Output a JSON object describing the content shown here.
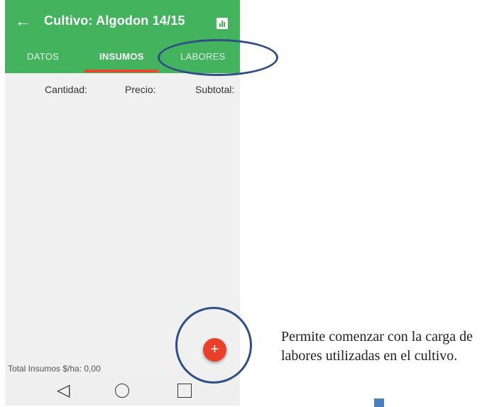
{
  "appbar": {
    "title": "Cultivo: Algodon 14/15",
    "back_icon": "arrow-left-icon",
    "chart_icon": "bar-chart-icon"
  },
  "tabs": [
    {
      "label": "DATOS",
      "active": false
    },
    {
      "label": "INSUMOS",
      "active": true
    },
    {
      "label": "LABORES",
      "active": false
    }
  ],
  "columns": {
    "cantidad": "Cantidad:",
    "precio": "Precio:",
    "subtotal": "Subtotal:"
  },
  "footer": {
    "total_label": "Total Insumos $/ha: 0,00"
  },
  "fab": {
    "label": "+"
  },
  "annotation": {
    "text": "Permite comenzar con la carga de labores utilizadas en el cultivo."
  },
  "colors": {
    "appbar": "#43b35e",
    "tab_indicator": "#e6492d",
    "fab": "#e8402a",
    "annotation_outline": "#2f4f86"
  }
}
